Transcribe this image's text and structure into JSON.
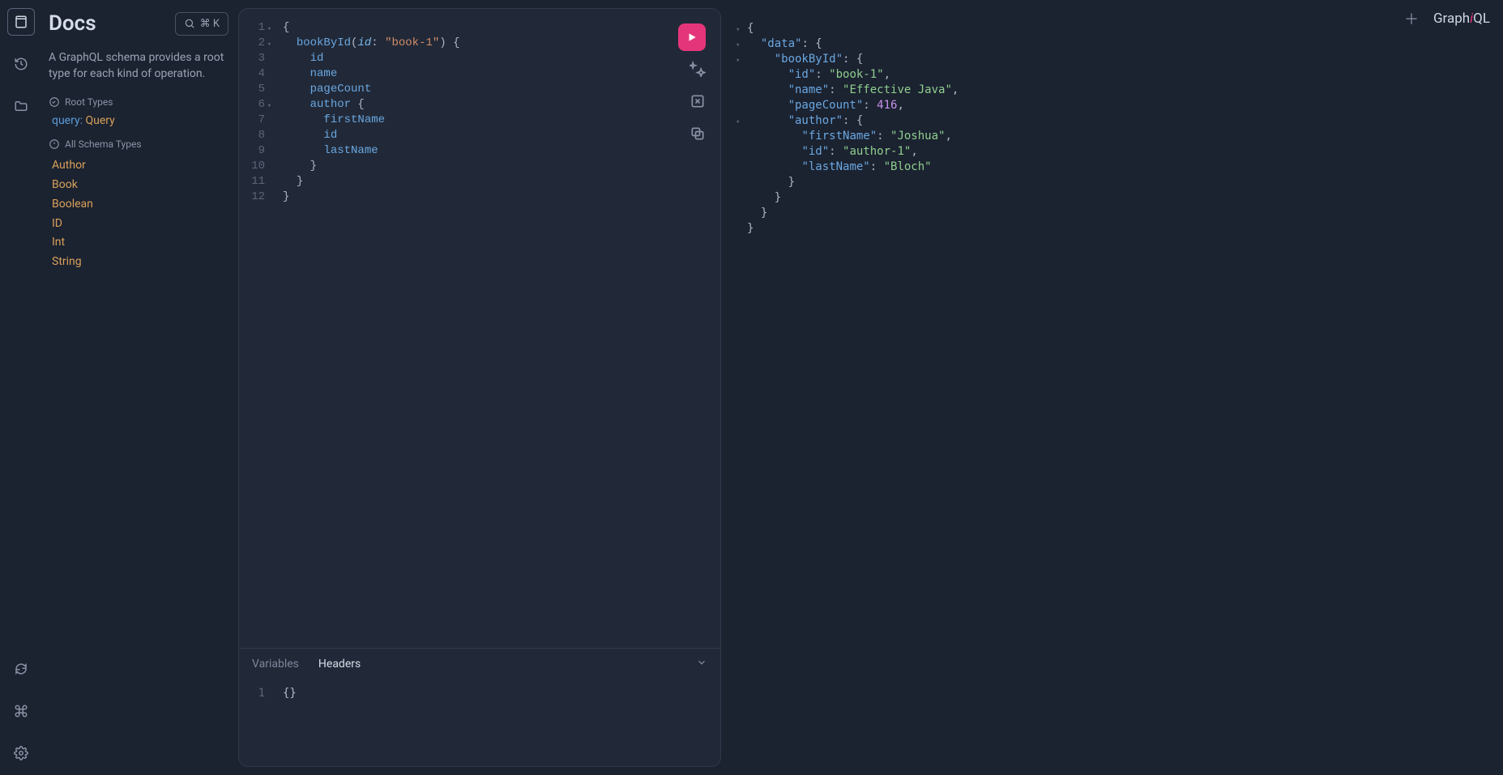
{
  "docs": {
    "title": "Docs",
    "search_shortcut": "⌘ K",
    "description": "A GraphQL schema provides a root type for each kind of operation.",
    "root_types_label": "Root Types",
    "root_query_kw": "query:",
    "root_query_type": "Query",
    "all_schema_label": "All Schema Types",
    "schema_types": [
      "Author",
      "Book",
      "Boolean",
      "ID",
      "Int",
      "String"
    ]
  },
  "editor": {
    "line_numbers": [
      "1",
      "2",
      "3",
      "4",
      "5",
      "6",
      "7",
      "8",
      "9",
      "10",
      "11",
      "12"
    ],
    "fold_lines": [
      1,
      2,
      6
    ],
    "tokens": [
      [
        {
          "c": "t-punc",
          "t": "{"
        }
      ],
      [
        {
          "c": "t-plain",
          "t": "  "
        },
        {
          "c": "t-field",
          "t": "bookById"
        },
        {
          "c": "t-punc",
          "t": "("
        },
        {
          "c": "t-arg",
          "t": "id"
        },
        {
          "c": "t-punc",
          "t": ": "
        },
        {
          "c": "t-str",
          "t": "\"book-1\""
        },
        {
          "c": "t-punc",
          "t": ") {"
        }
      ],
      [
        {
          "c": "t-plain",
          "t": "    "
        },
        {
          "c": "t-field",
          "t": "id"
        }
      ],
      [
        {
          "c": "t-plain",
          "t": "    "
        },
        {
          "c": "t-field",
          "t": "name"
        }
      ],
      [
        {
          "c": "t-plain",
          "t": "    "
        },
        {
          "c": "t-field",
          "t": "pageCount"
        }
      ],
      [
        {
          "c": "t-plain",
          "t": "    "
        },
        {
          "c": "t-field",
          "t": "author"
        },
        {
          "c": "t-punc",
          "t": " {"
        }
      ],
      [
        {
          "c": "t-plain",
          "t": "      "
        },
        {
          "c": "t-field",
          "t": "firstName"
        }
      ],
      [
        {
          "c": "t-plain",
          "t": "      "
        },
        {
          "c": "t-field",
          "t": "id"
        }
      ],
      [
        {
          "c": "t-plain",
          "t": "      "
        },
        {
          "c": "t-field",
          "t": "lastName"
        }
      ],
      [
        {
          "c": "t-plain",
          "t": "    "
        },
        {
          "c": "t-punc",
          "t": "}"
        }
      ],
      [
        {
          "c": "t-plain",
          "t": "  "
        },
        {
          "c": "t-punc",
          "t": "}"
        }
      ],
      [
        {
          "c": "t-punc",
          "t": "}"
        }
      ]
    ]
  },
  "bottom": {
    "tab_variables": "Variables",
    "tab_headers": "Headers",
    "gutter": "1",
    "body": "{}"
  },
  "response": {
    "lines": [
      {
        "indent": 0,
        "fold": true,
        "tokens": [
          {
            "c": "r-punc",
            "t": "{"
          }
        ]
      },
      {
        "indent": 1,
        "fold": true,
        "tokens": [
          {
            "c": "r-key",
            "t": "\"data\""
          },
          {
            "c": "r-punc",
            "t": ": {"
          }
        ]
      },
      {
        "indent": 2,
        "fold": true,
        "tokens": [
          {
            "c": "r-key",
            "t": "\"bookById\""
          },
          {
            "c": "r-punc",
            "t": ": {"
          }
        ]
      },
      {
        "indent": 3,
        "tokens": [
          {
            "c": "r-key",
            "t": "\"id\""
          },
          {
            "c": "r-punc",
            "t": ": "
          },
          {
            "c": "r-str",
            "t": "\"book-1\""
          },
          {
            "c": "r-punc",
            "t": ","
          }
        ]
      },
      {
        "indent": 3,
        "tokens": [
          {
            "c": "r-key",
            "t": "\"name\""
          },
          {
            "c": "r-punc",
            "t": ": "
          },
          {
            "c": "r-str",
            "t": "\"Effective Java\""
          },
          {
            "c": "r-punc",
            "t": ","
          }
        ]
      },
      {
        "indent": 3,
        "tokens": [
          {
            "c": "r-key",
            "t": "\"pageCount\""
          },
          {
            "c": "r-punc",
            "t": ": "
          },
          {
            "c": "r-num",
            "t": "416"
          },
          {
            "c": "r-punc",
            "t": ","
          }
        ]
      },
      {
        "indent": 3,
        "fold": true,
        "tokens": [
          {
            "c": "r-key",
            "t": "\"author\""
          },
          {
            "c": "r-punc",
            "t": ": {"
          }
        ]
      },
      {
        "indent": 4,
        "tokens": [
          {
            "c": "r-key",
            "t": "\"firstName\""
          },
          {
            "c": "r-punc",
            "t": ": "
          },
          {
            "c": "r-str",
            "t": "\"Joshua\""
          },
          {
            "c": "r-punc",
            "t": ","
          }
        ]
      },
      {
        "indent": 4,
        "tokens": [
          {
            "c": "r-key",
            "t": "\"id\""
          },
          {
            "c": "r-punc",
            "t": ": "
          },
          {
            "c": "r-str",
            "t": "\"author-1\""
          },
          {
            "c": "r-punc",
            "t": ","
          }
        ]
      },
      {
        "indent": 4,
        "tokens": [
          {
            "c": "r-key",
            "t": "\"lastName\""
          },
          {
            "c": "r-punc",
            "t": ": "
          },
          {
            "c": "r-str",
            "t": "\"Bloch\""
          }
        ]
      },
      {
        "indent": 3,
        "tokens": [
          {
            "c": "r-punc",
            "t": "}"
          }
        ]
      },
      {
        "indent": 2,
        "tokens": [
          {
            "c": "r-punc",
            "t": "}"
          }
        ]
      },
      {
        "indent": 1,
        "tokens": [
          {
            "c": "r-punc",
            "t": "}"
          }
        ]
      },
      {
        "indent": 0,
        "tokens": [
          {
            "c": "r-punc",
            "t": "}"
          }
        ]
      }
    ]
  },
  "brand": {
    "prefix": "Graph",
    "italic": "i",
    "suffix": "QL"
  }
}
